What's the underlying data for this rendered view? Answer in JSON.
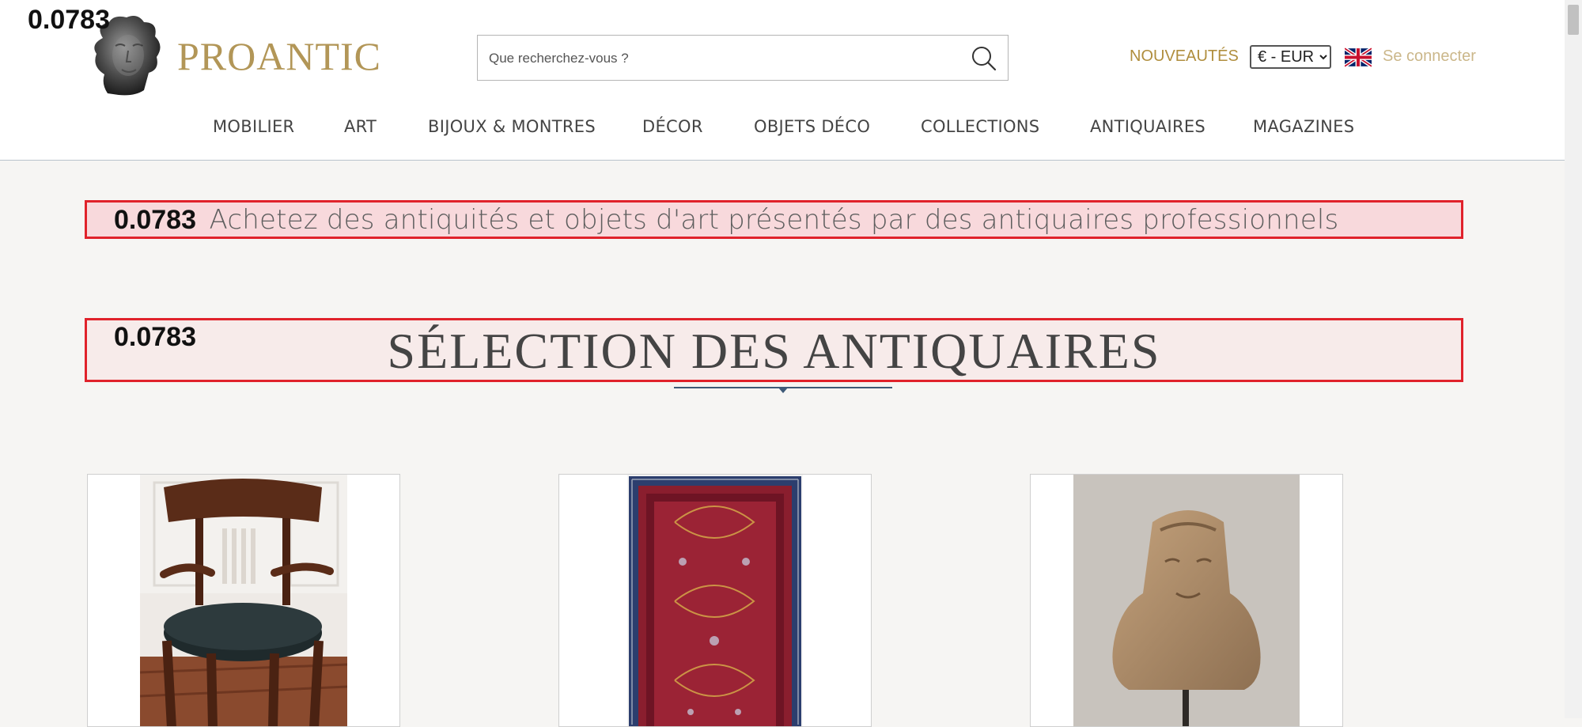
{
  "overlay": {
    "score": "0.0783"
  },
  "header": {
    "brand": "PROANTIC",
    "search": {
      "placeholder": "Que recherchez-vous ?",
      "value": ""
    },
    "new_label": "NOUVEAUTÉS",
    "currency": {
      "selected": "€ - EUR",
      "options": [
        "€ - EUR"
      ]
    },
    "language_flag": "uk-flag-icon",
    "login_label": "Se connecter"
  },
  "nav": {
    "items": [
      {
        "label": "MOBILIER"
      },
      {
        "label": "ART"
      },
      {
        "label": "BIJOUX & MONTRES"
      },
      {
        "label": "DÉCOR"
      },
      {
        "label": "OBJETS DÉCO"
      },
      {
        "label": "COLLECTIONS"
      },
      {
        "label": "ANTIQUAIRES"
      },
      {
        "label": "MAGAZINES"
      }
    ]
  },
  "main": {
    "banner_text": "Achetez des antiquités et objets d'art présentés par des antiquaires professionnels",
    "section_title": "SÉLECTION DES ANTIQUAIRES",
    "cards": [
      {
        "image": "armchair-image"
      },
      {
        "image": "rug-image"
      },
      {
        "image": "stone-bust-image"
      }
    ]
  },
  "colors": {
    "brand_gold": "#b29657",
    "nav_text": "#444444",
    "highlight_border": "#e0222b",
    "page_bg": "#f6f5f3"
  }
}
